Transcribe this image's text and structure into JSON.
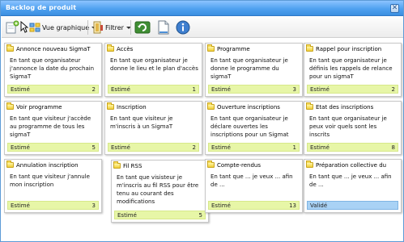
{
  "window": {
    "title": "Backlog de produit",
    "close_glyph": "✕"
  },
  "toolbar": {
    "view_label": "Vue graphique",
    "filter_label": "Filtrer",
    "icons": [
      "new-item-icon",
      "cursor-icon",
      "view-graphic-icon",
      "filter-icon",
      "refresh-icon",
      "document-icon",
      "info-icon"
    ]
  },
  "cards": [
    {
      "title": "Annonce nouveau SigmaT",
      "body": "En tant que organisateur j'annonce la date du prochain SigmaT",
      "status": "Estimé",
      "points": "2"
    },
    {
      "title": "Accès",
      "body": "En tant que organisateur je donne le lieu et le plan d'accès",
      "status": "Estimé",
      "points": "1"
    },
    {
      "title": "Programme",
      "body": "En tant que organisateur je donne le programme du sigmaT",
      "status": "Estimé",
      "points": "3"
    },
    {
      "title": "Rappel pour inscription",
      "body": "En tant que organisateur je définis les rappels de relance pour un sigmaT",
      "status": "Estimé",
      "points": "2"
    },
    {
      "title": "Voir programme",
      "body": "En tant que visiteur j'accède au programme de tous les sigmaT",
      "status": "Estimé",
      "points": "5"
    },
    {
      "title": "Inscription",
      "body": "En tant que visiteur je m'inscris à un SigmaT",
      "status": "Estimé",
      "points": "2"
    },
    {
      "title": "Ouverture inscriptions",
      "body": "En tant que organisateur je déclare ouvertes les inscriptions pour un Sigmat",
      "status": "Estimé",
      "points": "1"
    },
    {
      "title": "Etat des inscriptions",
      "body": "En tant que organisateur je peux voir quels sont les inscrits",
      "status": "Estimé",
      "points": "8"
    },
    {
      "title": "Annulation inscription",
      "body": "En tant que visiteur j'annule mon inscription",
      "status": "Estimé",
      "points": "3"
    },
    {
      "title": "Fil RSS",
      "body": "En tant que visisteur je m'inscris au fil RSS pour être tenu au courant des modifications",
      "status": "Estimé",
      "points": "5"
    },
    {
      "title": "Compte-rendus",
      "body": "En tant que ... je veux ... afin de ...",
      "status": "Estimé",
      "points": "13"
    },
    {
      "title": "Préparation collective du",
      "body": "En tant que ... je veux ... afin de ...",
      "status": "Validé",
      "points": ""
    }
  ]
}
